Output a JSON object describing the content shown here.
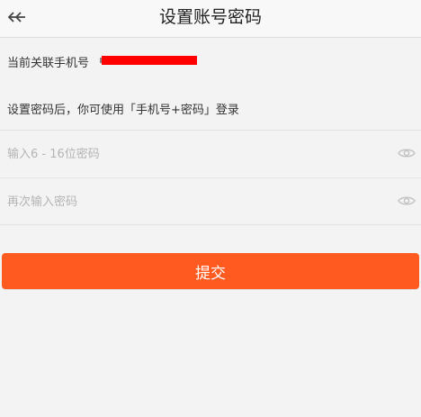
{
  "header": {
    "title": "设置账号密码",
    "back_icon": "back-arrow-icon"
  },
  "phone": {
    "label": "当前关联手机号 ",
    "value_redacted": true,
    "redact_color": "#ff0000"
  },
  "hint": "设置密码后，你可使用「手机号+密码」登录",
  "form": {
    "password": {
      "placeholder": "输入6 - 16位密码",
      "value": "",
      "visibility_icon": "eye-icon"
    },
    "confirm": {
      "placeholder": "再次输入密码",
      "value": "",
      "visibility_icon": "eye-icon"
    }
  },
  "submit": {
    "label": "提交",
    "color": "#ff5a1f"
  }
}
